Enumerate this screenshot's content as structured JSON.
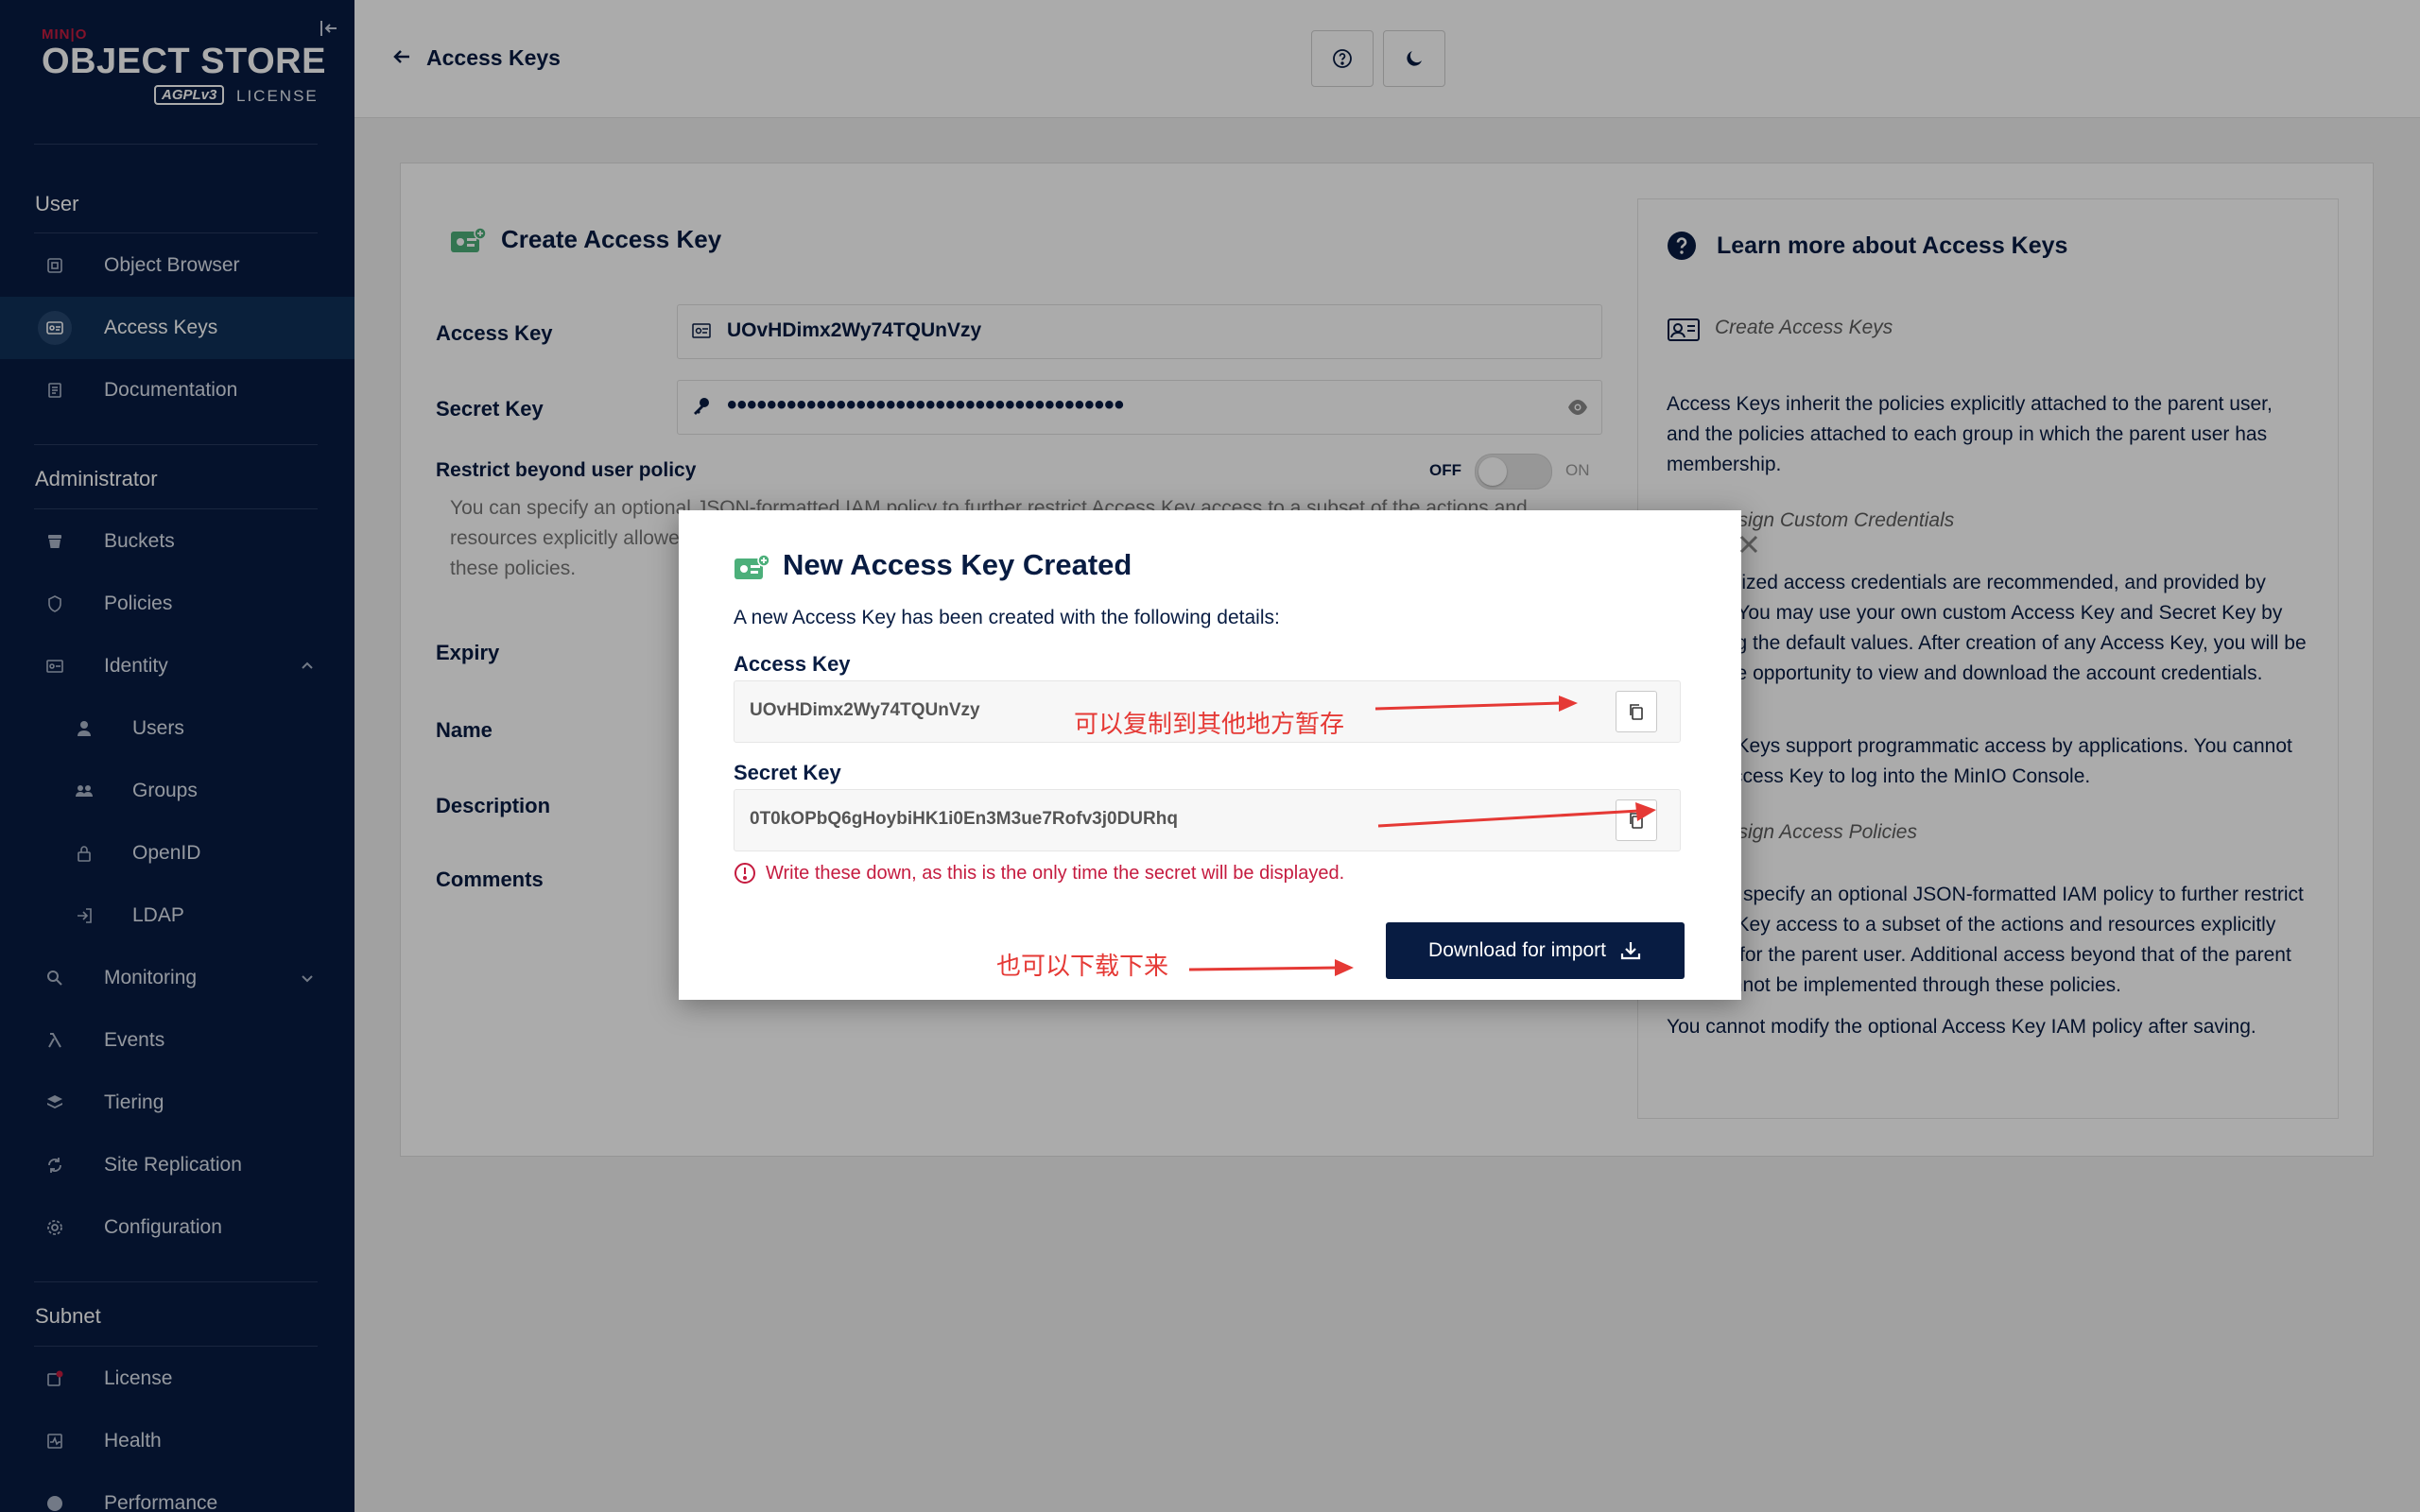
{
  "brand": {
    "logo_top": "MIN|O",
    "logo_main": "OBJECT STORE",
    "logo_badge": "AGPLv3",
    "logo_license": "LICENSE"
  },
  "sidebar": {
    "sections": {
      "user": "User",
      "administrator": "Administrator",
      "subnet": "Subnet"
    },
    "items": [
      {
        "label": "Object Browser",
        "icon": "object-browser-icon"
      },
      {
        "label": "Access Keys",
        "icon": "access-keys-icon",
        "active": true
      },
      {
        "label": "Documentation",
        "icon": "documentation-icon"
      },
      {
        "label": "Buckets",
        "icon": "buckets-icon"
      },
      {
        "label": "Policies",
        "icon": "policies-icon"
      },
      {
        "label": "Identity",
        "icon": "identity-icon",
        "expanded": true
      },
      {
        "label": "Users",
        "icon": "users-icon"
      },
      {
        "label": "Groups",
        "icon": "groups-icon"
      },
      {
        "label": "OpenID",
        "icon": "openid-icon"
      },
      {
        "label": "LDAP",
        "icon": "ldap-icon"
      },
      {
        "label": "Monitoring",
        "icon": "monitoring-icon"
      },
      {
        "label": "Events",
        "icon": "lambda-icon"
      },
      {
        "label": "Tiering",
        "icon": "tiering-icon"
      },
      {
        "label": "Site Replication",
        "icon": "site-replication-icon"
      },
      {
        "label": "Configuration",
        "icon": "gear-icon"
      },
      {
        "label": "License",
        "icon": "license-icon"
      },
      {
        "label": "Health",
        "icon": "health-icon"
      },
      {
        "label": "Performance",
        "icon": "performance-icon"
      }
    ]
  },
  "header": {
    "title": "Access Keys"
  },
  "form": {
    "title": "Create Access Key",
    "access_key_label": "Access Key",
    "access_key_value": "UOvHDimx2Wy74TQUnVzy",
    "secret_key_label": "Secret Key",
    "secret_key_mask": "••••••••••••••••••••••••••••••••••••••••",
    "restrict_label": "Restrict beyond user policy",
    "toggle_off": "OFF",
    "toggle_on": "ON",
    "restrict_desc": "You can specify an optional JSON-formatted IAM policy to further restrict Access Key access to a subset of the actions and resources explicitly allowed for the parent user. Additional access beyond that of the parent user cannot be implemented through these policies.",
    "expiry_label": "Expiry",
    "name_label": "Name",
    "description_label": "Description",
    "comments_label": "Comments"
  },
  "help": {
    "title": "Learn more about Access Keys",
    "sub_create": "Create Access Keys",
    "para1": "Access Keys inherit the policies explicitly attached to the parent user, and the policies attached to each group in which the parent user has membership.",
    "sub_custom": "Assign Custom Credentials",
    "para2": "Randomized access credentials are recommended, and provided by default. You may use your own custom Access Key and Secret Key by replacing the default values. After creation of any Access Key, you will be given the opportunity to view and download the account credentials.",
    "para3": "Access Keys support programmatic access by applications. You cannot use a Access Key to log into the MinIO Console.",
    "sub_policies": "Assign Access Policies",
    "para4": "You can specify an optional JSON-formatted IAM policy to further restrict Access Key access to a subset of the actions and resources explicitly allowed for the parent user. Additional access beyond that of the parent user cannot be implemented through these policies.",
    "para5": "You cannot modify the optional Access Key IAM policy after saving."
  },
  "modal": {
    "title": "New Access Key Created",
    "description": "A new Access Key has been created with the following details:",
    "access_key_label": "Access Key",
    "access_key_value": "UOvHDimx2Wy74TQUnVzy",
    "secret_key_label": "Secret Key",
    "secret_key_value": "0T0kOPbQ6gHoybiHK1i0En3M3ue7Rofv3j0DURhq",
    "warning": "Write these down, as this is the only time the secret will be displayed.",
    "download_label": "Download for import"
  },
  "annotations": {
    "copy_note": "可以复制到其他地方暂存",
    "download_note": "也可以下载下来"
  },
  "colors": {
    "sidebar_bg": "#081c42",
    "active_item_bg": "#0f3158",
    "accent_red": "#c51b3f",
    "annotation_red": "#e53935",
    "key_icon_green": "#4caf7a"
  }
}
